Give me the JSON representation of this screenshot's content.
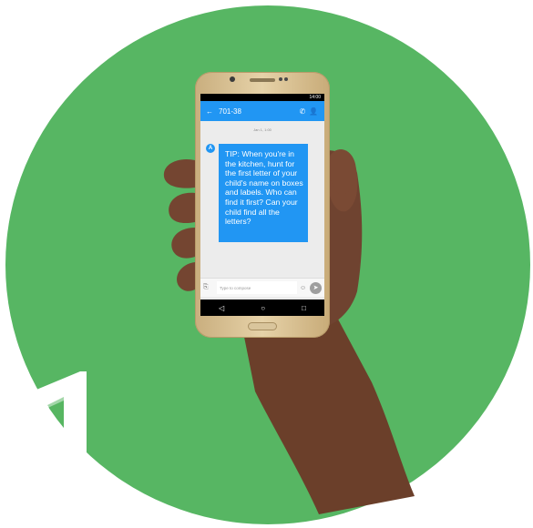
{
  "status_time": "14:00",
  "conversation": {
    "back_glyph": "←",
    "title": "701-38",
    "call_glyph": "✆",
    "contact_glyph": "👤",
    "date_stamp": "Jan 1, 1:00",
    "avatar_letter": "A",
    "message": "TIP: When you're in the kitchen, hunt for the first letter of your child's name on boxes and labels. Who can find it first? Can your child find all the letters?"
  },
  "composer": {
    "placeholder": "Type to compose",
    "attach_glyph": "⎘",
    "emoji_glyph": "☺",
    "send_glyph": "➤"
  },
  "navbar": {
    "back": "◁",
    "home": "○",
    "recents": "□"
  },
  "colors": {
    "disc": "#57b663",
    "bubble": "#2196f3",
    "appbar": "#2196f3"
  }
}
